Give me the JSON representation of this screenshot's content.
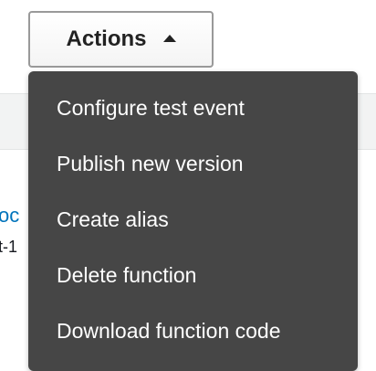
{
  "background": {
    "link_fragment": "oc",
    "text_fragment": "t-1"
  },
  "actions_button": {
    "label": "Actions",
    "caret_icon": "caret-up-icon"
  },
  "menu": {
    "items": [
      {
        "label": "Configure test event"
      },
      {
        "label": "Publish new version"
      },
      {
        "label": "Create alias"
      },
      {
        "label": "Delete function"
      },
      {
        "label": "Download function code"
      }
    ]
  },
  "colors": {
    "menu_background": "#464646",
    "menu_text": "#ffffff",
    "link": "#0073bb"
  }
}
